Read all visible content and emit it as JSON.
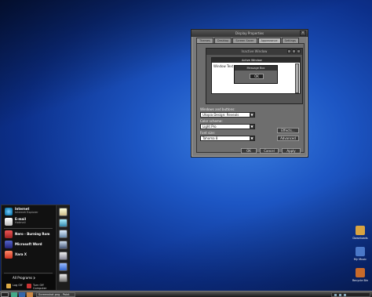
{
  "dialog": {
    "title": "Display Properties",
    "tabs": [
      "Themes",
      "Desktop",
      "Screen Saver",
      "Appearance",
      "Settings"
    ],
    "active_tab": "Appearance",
    "preview": {
      "title": "Inactive Window",
      "active_window_title": "Active Window",
      "window_text": "Window Text",
      "message_box_title": "Message Box",
      "ok_label": "OK"
    },
    "labels": {
      "windows_buttons": "Windows and buttons:",
      "color_scheme": "Color scheme:",
      "font_size": "Font size:"
    },
    "values": {
      "windows_buttons": "Utopia Design: Reveals",
      "color_scheme": "Light Pro",
      "font_size": "Tahoma 8"
    },
    "buttons": {
      "effects": "Effects...",
      "advanced": "Advanced",
      "ok": "OK",
      "cancel": "Cancel",
      "apply": "Apply"
    }
  },
  "start_menu": {
    "items": [
      {
        "title": "Internet",
        "subtitle": "Internet Explorer"
      },
      {
        "title": "E-mail",
        "subtitle": "Hotmail"
      },
      {
        "title": "Nero - Burning Rom",
        "subtitle": ""
      },
      {
        "title": "Microsoft Word",
        "subtitle": ""
      },
      {
        "title": "Xara X",
        "subtitle": ""
      }
    ],
    "all_programs": "All Programs",
    "log_off": "Log Off",
    "turn_off": "Turn Off Computer"
  },
  "taskbar": {
    "task_label": "Screenshot.png - Paint"
  },
  "desktop_icons": [
    {
      "label": "Downloads",
      "color": "#d9a441"
    },
    {
      "label": "My Music",
      "color": "#4a78c8"
    },
    {
      "label": "Recycle Bin",
      "color": "#c86a2a"
    }
  ]
}
